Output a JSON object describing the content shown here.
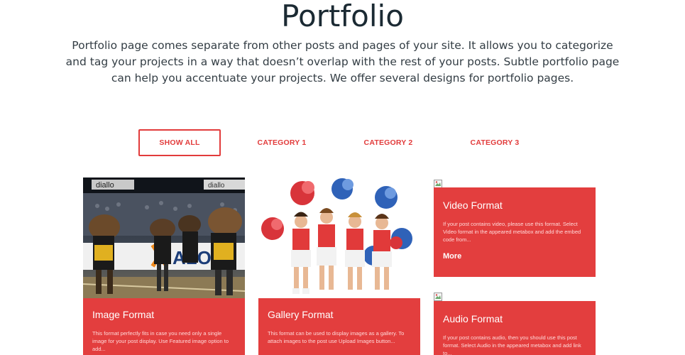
{
  "header": {
    "title": "Portfolio",
    "intro": "Portfolio page comes separate from other posts and pages of your site. It allows you to categorize and tag your projects in a way that doesn’t overlap with the rest of your posts. Subtle portfolio page can help you accentuate your projects. We offer several designs for portfolio pages."
  },
  "filters": [
    {
      "label": "SHOW ALL",
      "active": true
    },
    {
      "label": "CATEGORY 1",
      "active": false
    },
    {
      "label": "CATEGORY 2",
      "active": false
    },
    {
      "label": "CATEGORY 3",
      "active": false
    }
  ],
  "cards": [
    {
      "title": "Image Format",
      "description": "This format perfectly fits in case you need only a single image for your post display. Use Featured image option to add...",
      "image": "basketball-cheerleaders-photo"
    },
    {
      "title": "Gallery Format",
      "description": "This format can be used to display images as a gallery. To attach images to the post use Upload Images button...",
      "image": "cheerleaders-pompoms-photo"
    },
    {
      "title": "Video Format",
      "description": "If your post contains video, please use this format. Select Video format in the appeared metabox and add the embed code from...",
      "more_label": "More",
      "image": "broken-image-icon"
    },
    {
      "title": "Audio Format",
      "description": "If your post contains audio, then you should use this post format. Select Audio in the appeared metabox and add link to...",
      "image": "broken-image-icon"
    }
  ],
  "colors": {
    "accent": "#e33e3e",
    "title": "#1b2a33",
    "text": "#333d44"
  }
}
